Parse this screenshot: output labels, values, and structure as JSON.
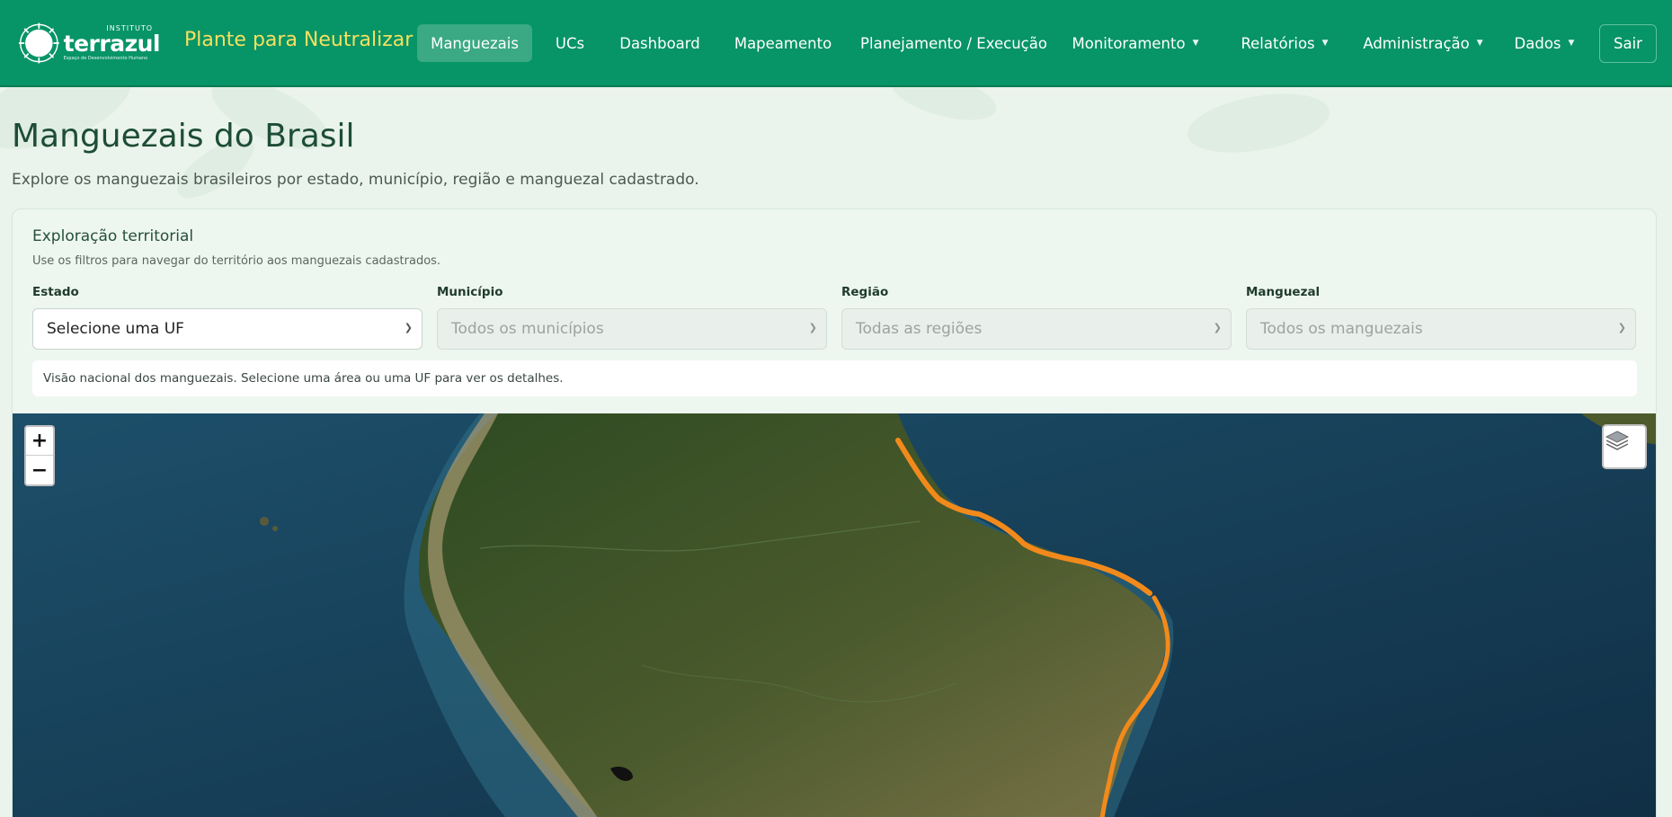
{
  "brand": {
    "logo_small": "INSTITUTO",
    "logo_name": "terrazul",
    "logo_tagline": "Espaço de Desenvolvimento Humano",
    "name": "Plante para Neutralizar"
  },
  "nav": {
    "items": [
      {
        "label": "Manguezais",
        "active": true
      },
      {
        "label": "UCs"
      },
      {
        "label": "Dashboard"
      },
      {
        "label": "Mapeamento"
      },
      {
        "label": "Planejamento / Execução"
      },
      {
        "label": "Monitoramento",
        "dropdown": true
      },
      {
        "label": "Relatórios",
        "dropdown": true
      },
      {
        "label": "Administração",
        "dropdown": true
      },
      {
        "label": "Dados",
        "dropdown": true
      }
    ],
    "logout": "Sair"
  },
  "page": {
    "title": "Manguezais do Brasil",
    "subtitle": "Explore os manguezais brasileiros por estado, município, região e manguezal cadastrado."
  },
  "explore": {
    "title": "Exploração territorial",
    "hint": "Use os filtros para navegar do território aos manguezais cadastrados.",
    "filters": [
      {
        "label": "Estado",
        "value": "Selecione uma UF",
        "disabled": false
      },
      {
        "label": "Município",
        "value": "Todos os municípios",
        "disabled": true
      },
      {
        "label": "Região",
        "value": "Todas as regiões",
        "disabled": true
      },
      {
        "label": "Manguezal",
        "value": "Todos os manguezais",
        "disabled": true
      }
    ],
    "info": "Visão nacional dos manguezais. Selecione uma área ou uma UF para ver os detalhes."
  },
  "map": {
    "zoom_in": "+",
    "zoom_out": "−",
    "layers_icon": "layers-icon",
    "mangrove_color": "#f28a1b"
  },
  "colors": {
    "navbar": "#079466",
    "brand": "#f6e05e",
    "active_nav": "#3aa984"
  }
}
